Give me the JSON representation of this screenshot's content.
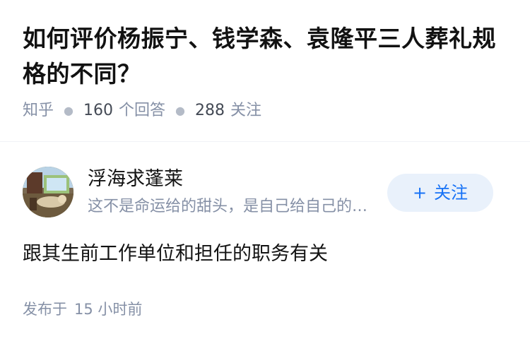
{
  "question": {
    "title": "如何评价杨振宁、钱学森、袁隆平三人葬礼规格的不同？",
    "source": "知乎",
    "answer_count": "160",
    "answer_label": "个回答",
    "follower_count": "288",
    "follower_label": "关注"
  },
  "author": {
    "name": "浮海求蓬莱",
    "bio": "这不是命运给的甜头，是自己给自己的甜头",
    "follow_label": "关注",
    "avatar_icon": "avatar-photo"
  },
  "answer": {
    "text": "跟其生前工作单位和担任的职务有关"
  },
  "footer": {
    "published_label": "发布于",
    "published_time": "15 小时前"
  },
  "colors": {
    "primary": "#1772f6",
    "follow_bg": "#e9f1fb",
    "meta_gray": "#8590a6",
    "text": "#121212"
  }
}
